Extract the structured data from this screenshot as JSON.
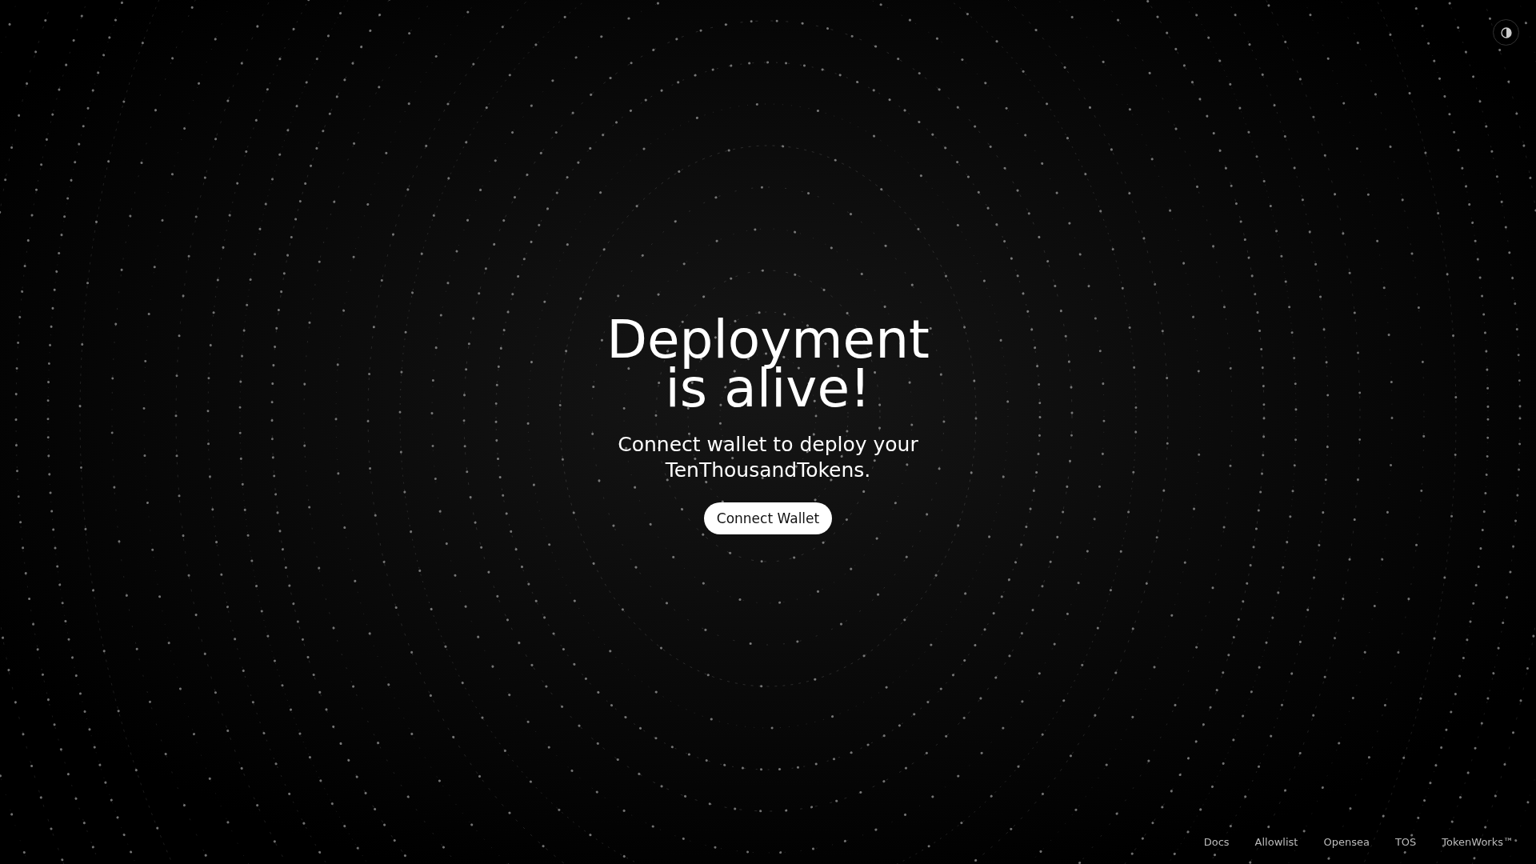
{
  "heading": {
    "lines": [
      "Deployment",
      "is alive!"
    ]
  },
  "subtitle": {
    "lines": [
      "Connect wallet to deploy your",
      "TenThousandTokens."
    ]
  },
  "connect_button": {
    "label": "Connect Wallet"
  },
  "footer_links": [
    "Docs",
    "Allowlist",
    "Opensea",
    "TOS",
    "TokenWorks™"
  ]
}
